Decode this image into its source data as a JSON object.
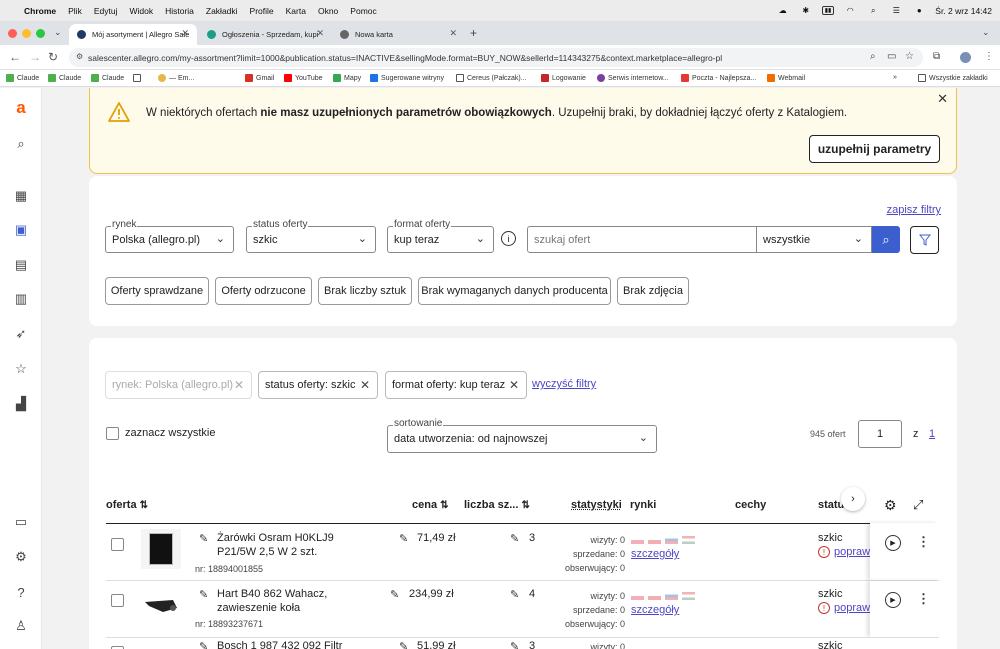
{
  "menubar": {
    "app": "Chrome",
    "items": [
      "Plik",
      "Edytuj",
      "Widok",
      "Historia",
      "Zakładki",
      "Profile",
      "Karta",
      "Okno",
      "Pomoc"
    ],
    "datetime": "Śr. 2 wrz  14:42"
  },
  "tabs": [
    {
      "title": "Mój asortyment | Allegro Sale",
      "active": true
    },
    {
      "title": "Ogłoszenia - Sprzedam, kupi",
      "active": false
    },
    {
      "title": "Nowa karta",
      "active": false
    }
  ],
  "address": {
    "url": "salescenter.allegro.com/my-assortment?limit=1000&publication.status=INACTIVE&sellingMode.format=BUY_NOW&sellerId=114343275&context.marketplace=allegro-pl"
  },
  "bookmarks": {
    "items": [
      "Claude",
      "Claude",
      "Claude",
      "— Em...",
      "Gmail",
      "YouTube",
      "Mapy",
      "Sugerowane witryny",
      "Cereus (Pałczak)...",
      "Logowanie",
      "Serwis internetow...",
      "Poczta - Najlepsza...",
      "Webmail"
    ],
    "all_label": "Wszystkie zakładki"
  },
  "warning": {
    "text_before": "W niektórych ofertach ",
    "text_bold": "nie masz uzupełnionych parametrów obowiązkowych",
    "text_after": ". Uzupełnij braki, by dokładniej łączyć oferty z Katalogiem.",
    "button": "uzupełnij parametry"
  },
  "filters": {
    "save_link": "zapisz filtry",
    "market": {
      "label": "rynek",
      "value": "Polska (allegro.pl)"
    },
    "status": {
      "label": "status oferty",
      "value": "szkic"
    },
    "format": {
      "label": "format oferty",
      "value": "kup teraz"
    },
    "search_placeholder": "szukaj ofert",
    "scope": "wszystkie",
    "quick": [
      "Oferty sprawdzane",
      "Oferty odrzucone",
      "Brak liczby sztuk",
      "Brak wymaganych danych producenta",
      "Brak zdjęcia"
    ]
  },
  "active_filters": {
    "chips": [
      "rynek: Polska (allegro.pl)",
      "status oferty: szkic",
      "format oferty: kup teraz"
    ],
    "clear": "wyczyść filtry"
  },
  "list": {
    "select_all": "zaznacz wszystkie",
    "sort_label": "sortowanie",
    "sort_value": "data utworzenia: od najnowszej",
    "count": "945 ofert",
    "page": "1",
    "page_sep": "z",
    "page_total": "1",
    "columns": [
      "oferta",
      "cena",
      "liczba sz...",
      "statystyki",
      "rynki",
      "cechy",
      "status"
    ],
    "stat_labels": [
      "wizyty:",
      "sprzedane:",
      "obserwujący:"
    ],
    "details_link": "szczegóły",
    "fix_link": "popraw b",
    "rows": [
      {
        "title_l1": "Żarówki Osram H0KLJ9",
        "title_l2": "P21/5W 2,5 W 2 szt.",
        "nr": "nr: 18894001855",
        "price": "71,49 zł",
        "qty": "3",
        "visits": "0",
        "sold": "0",
        "watch": "0",
        "status": "szkic"
      },
      {
        "title_l1": "Hart B40 862 Wahacz,",
        "title_l2": "zawieszenie koła",
        "nr": "nr: 18893237671",
        "price": "234,99 zł",
        "qty": "4",
        "visits": "0",
        "sold": "0",
        "watch": "0",
        "status": "szkic"
      },
      {
        "title_l1": "Bosch 1 987 432 092 Filtr",
        "title_l2": "",
        "nr": "",
        "price": "51,99 zł",
        "qty": "3",
        "visits": "0",
        "sold": "",
        "watch": "",
        "status": "szkic"
      }
    ]
  },
  "colors": {
    "accent": "#4e46c3",
    "brand": "#ff5a00",
    "search_btn": "#3c5fcf",
    "warning_border": "#f0c24a"
  }
}
